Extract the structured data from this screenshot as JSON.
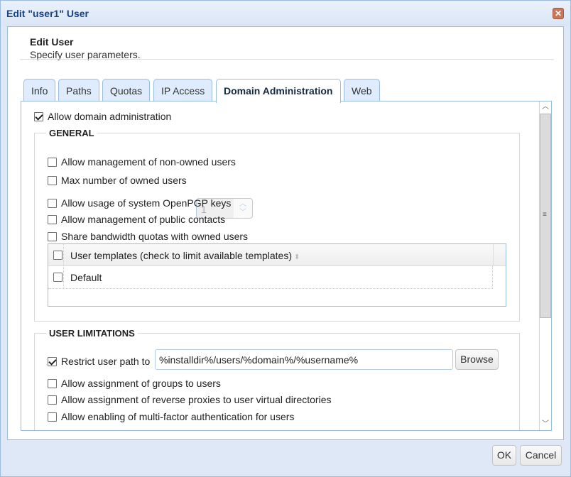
{
  "window": {
    "title": "Edit \"user1\" User",
    "close_icon": "close-x-icon"
  },
  "header": {
    "title": "Edit User",
    "subtitle": "Specify user parameters."
  },
  "tabs": [
    {
      "label": "Info",
      "active": false
    },
    {
      "label": "Paths",
      "active": false
    },
    {
      "label": "Quotas",
      "active": false
    },
    {
      "label": "IP Access",
      "active": false
    },
    {
      "label": "Domain Administration",
      "active": true
    },
    {
      "label": "Web",
      "active": false
    }
  ],
  "domain_admin": {
    "allow_label": "Allow domain administration",
    "allow_checked": true,
    "general": {
      "legend": "GENERAL",
      "options": [
        {
          "label": "Allow management of non-owned users",
          "checked": false
        },
        {
          "label": "Max number of owned users",
          "checked": false
        },
        {
          "label": "Allow usage of system OpenPGP keys",
          "checked": false
        },
        {
          "label": "Allow management of public contacts",
          "checked": false
        },
        {
          "label": "Share bandwidth quotas with owned users",
          "checked": false
        }
      ],
      "max_owned_users_value": "1",
      "templates_grid": {
        "header": "User templates (check to limit available templates)",
        "rows": [
          {
            "name": "Default",
            "checked": false
          }
        ]
      }
    },
    "user_limitations": {
      "legend": "USER LIMITATIONS",
      "restrict_path_label": "Restrict user path to",
      "restrict_path_checked": true,
      "restrict_path_value": "%installdir%/users/%domain%/%username%",
      "browse_label": "Browse",
      "options": [
        {
          "label": "Allow assignment of groups to users",
          "checked": false
        },
        {
          "label": "Allow assignment of reverse proxies to user virtual directories",
          "checked": false
        },
        {
          "label": "Allow enabling of multi-factor authentication for users",
          "checked": false
        }
      ]
    }
  },
  "footer": {
    "ok_label": "OK",
    "cancel_label": "Cancel"
  }
}
